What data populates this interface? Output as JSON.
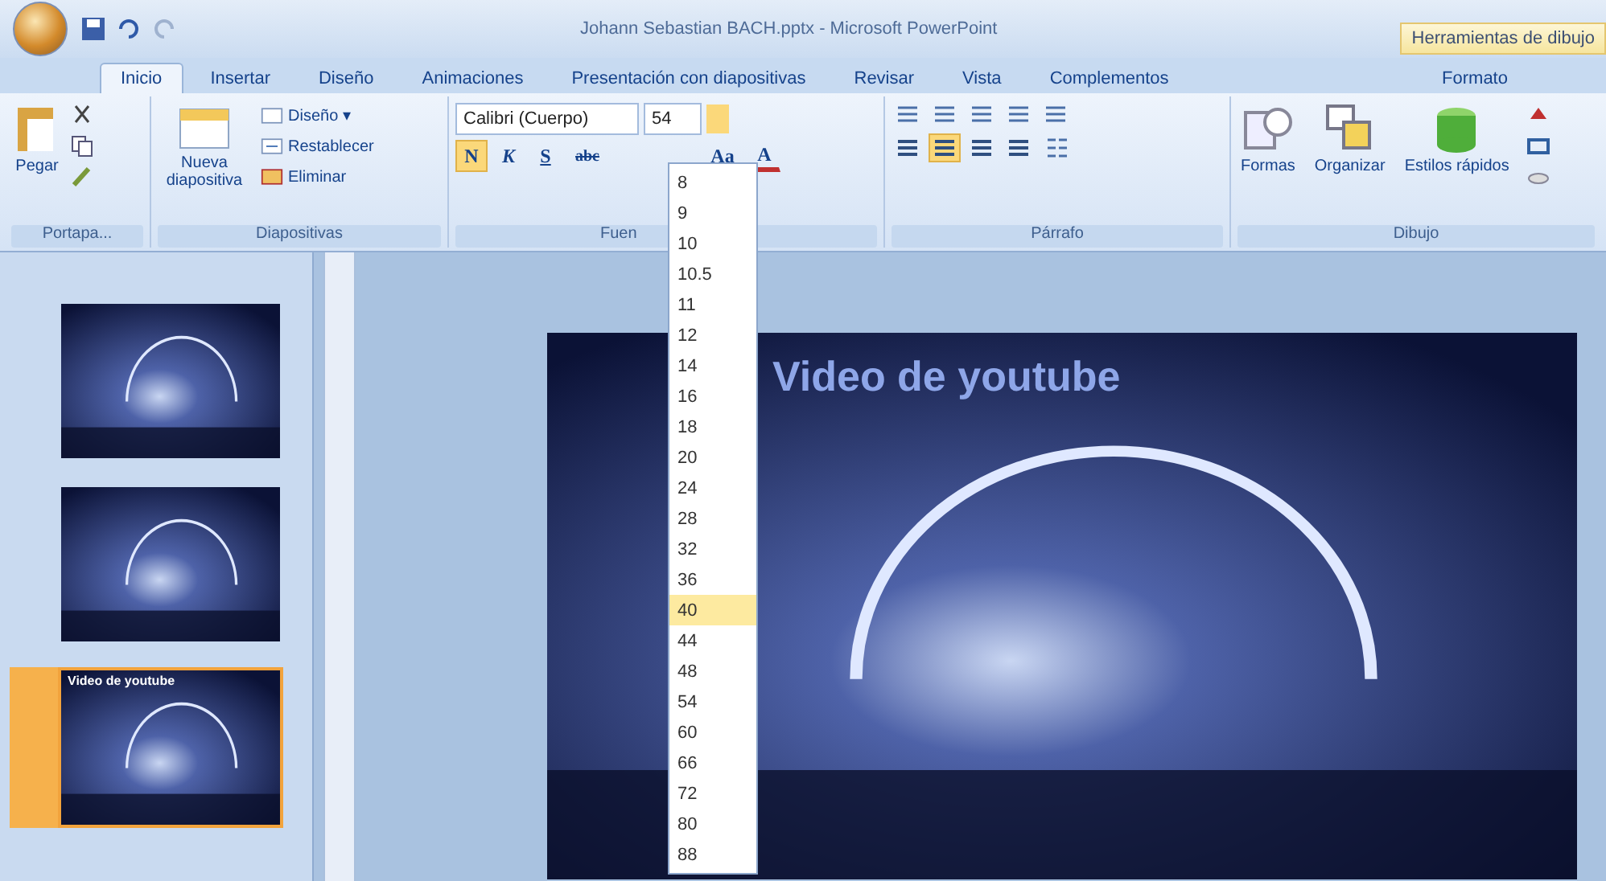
{
  "window": {
    "title": "Johann Sebastian BACH.pptx - Microsoft PowerPoint",
    "contextual_tab": "Herramientas de dibujo"
  },
  "tabs": [
    {
      "label": "Inicio",
      "selected": true
    },
    {
      "label": "Insertar",
      "selected": false
    },
    {
      "label": "Diseño",
      "selected": false
    },
    {
      "label": "Animaciones",
      "selected": false
    },
    {
      "label": "Presentación con diapositivas",
      "selected": false
    },
    {
      "label": "Revisar",
      "selected": false
    },
    {
      "label": "Vista",
      "selected": false
    },
    {
      "label": "Complementos",
      "selected": false
    },
    {
      "label": "Formato",
      "selected": false
    }
  ],
  "ribbon": {
    "clipboard": {
      "paste": "Pegar",
      "label": "Portapa..."
    },
    "slides": {
      "new_slide": "Nueva diapositiva",
      "layout": "Diseño",
      "layout_arrow": "▾",
      "reset": "Restablecer",
      "delete": "Eliminar",
      "label": "Diapositivas"
    },
    "font": {
      "font_name": "Calibri (Cuerpo)",
      "font_size": "54",
      "label": "Fuen",
      "styles": [
        {
          "label": "N",
          "selected": true
        },
        {
          "label": "K",
          "selected": false
        },
        {
          "label": "S",
          "selected": false
        },
        {
          "label": "abc",
          "selected": false
        }
      ],
      "case": "Aa",
      "font_color_letter": "A"
    },
    "paragraph": {
      "label": "Párrafo",
      "alignments": [
        {
          "selected": false
        },
        {
          "selected": true
        },
        {
          "selected": false
        },
        {
          "selected": false
        }
      ]
    },
    "drawing": {
      "shapes": "Formas",
      "arrange": "Organizar",
      "quick_styles": "Estilos rápidos",
      "label": "Dibujo"
    }
  },
  "font_size_list": [
    {
      "label": "8",
      "selected": false
    },
    {
      "label": "9",
      "selected": false
    },
    {
      "label": "10",
      "selected": false
    },
    {
      "label": "10.5",
      "selected": false
    },
    {
      "label": "11",
      "selected": false
    },
    {
      "label": "12",
      "selected": false
    },
    {
      "label": "14",
      "selected": false
    },
    {
      "label": "16",
      "selected": false
    },
    {
      "label": "18",
      "selected": false
    },
    {
      "label": "20",
      "selected": false
    },
    {
      "label": "24",
      "selected": false
    },
    {
      "label": "28",
      "selected": false
    },
    {
      "label": "32",
      "selected": false
    },
    {
      "label": "36",
      "selected": false
    },
    {
      "label": "40",
      "selected": true
    },
    {
      "label": "44",
      "selected": false
    },
    {
      "label": "48",
      "selected": false
    },
    {
      "label": "54",
      "selected": false
    },
    {
      "label": "60",
      "selected": false
    },
    {
      "label": "66",
      "selected": false
    },
    {
      "label": "72",
      "selected": false
    },
    {
      "label": "80",
      "selected": false
    },
    {
      "label": "88",
      "selected": false
    }
  ],
  "slides": [
    {
      "selected": false
    },
    {
      "selected": false
    },
    {
      "title": "Video de youtube",
      "selected": true
    }
  ],
  "current_slide": {
    "title": "Video de youtube"
  }
}
